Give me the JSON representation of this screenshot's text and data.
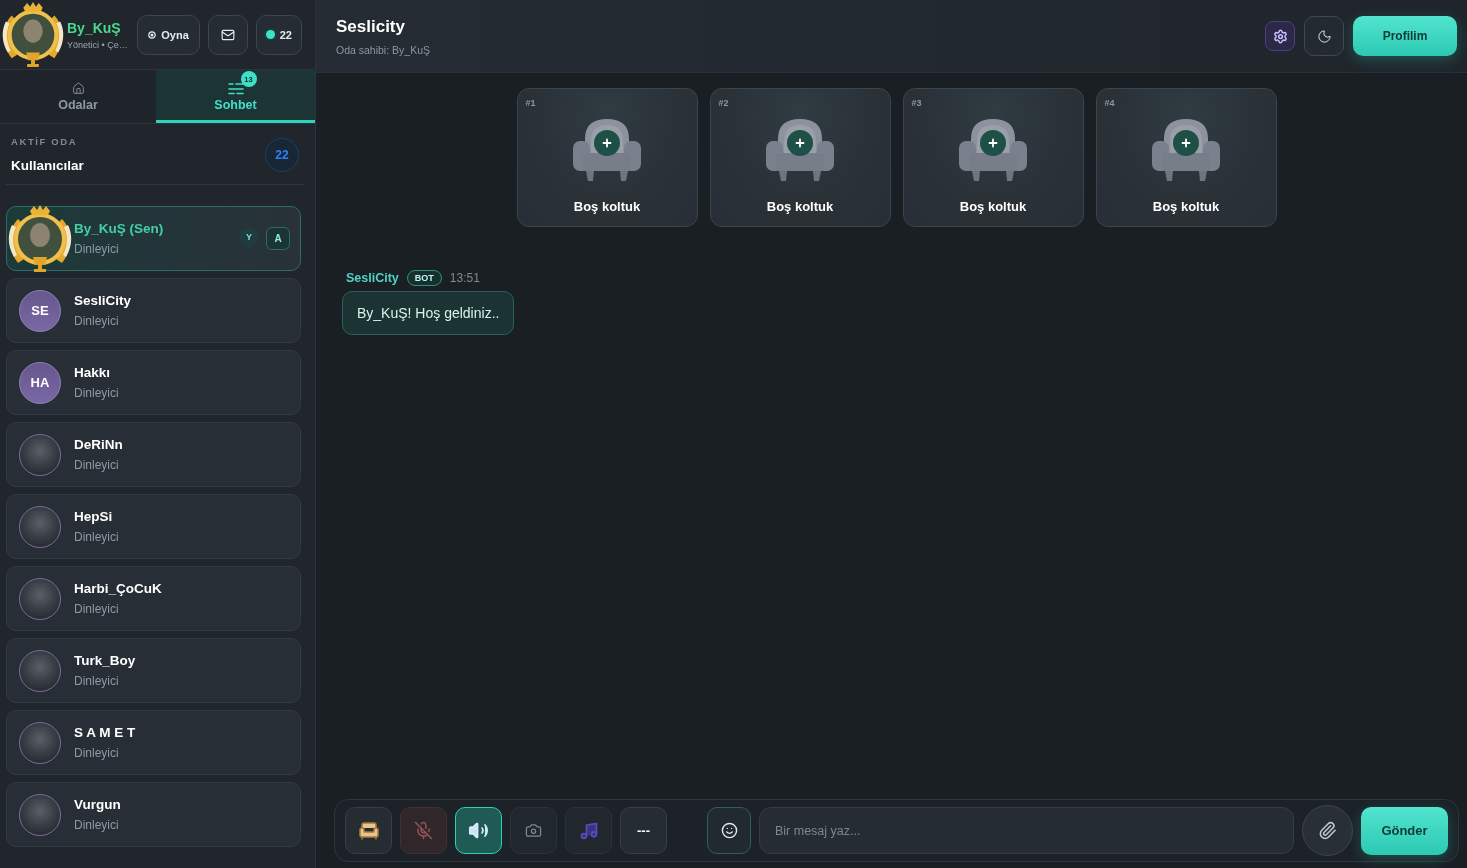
{
  "sidebar": {
    "profile": {
      "name": "By_KuŞ",
      "subtitle": "Yönetici • Çe…"
    },
    "actions": [
      {
        "kind": "play",
        "label": "Oyna"
      },
      {
        "kind": "mail"
      },
      {
        "kind": "online",
        "label": "22"
      }
    ],
    "tabs": [
      {
        "kind": "rooms",
        "label": "Odalar",
        "selected": false
      },
      {
        "kind": "chat",
        "label": "Sohbet",
        "badge": "13",
        "selected": true
      }
    ],
    "active_room": {
      "caption": "AKTİF ODA",
      "title": "Kullanıcılar",
      "count": "22"
    },
    "users": [
      {
        "kind": "self",
        "name": "By_KuŞ (Sen)",
        "role": "Dinleyici",
        "badge": "Y",
        "action": "A"
      },
      {
        "kind": "initials",
        "initials": "SE",
        "name": "SesliCity",
        "role": "Dinleyici"
      },
      {
        "kind": "initials",
        "initials": "HA",
        "name": "Hakkı",
        "role": "Dinleyici"
      },
      {
        "kind": "photo",
        "name": "DeRiNn",
        "role": "Dinleyici"
      },
      {
        "kind": "photo",
        "name": "HepSi",
        "role": "Dinleyici"
      },
      {
        "kind": "photo",
        "name": "Harbi_ÇoCuK",
        "role": "Dinleyici"
      },
      {
        "kind": "photo",
        "name": "Turk_Boy",
        "role": "Dinleyici"
      },
      {
        "kind": "photo",
        "name": "S A M E T",
        "role": "Dinleyici"
      },
      {
        "kind": "photo",
        "name": "Vurgun",
        "role": "Dinleyici"
      }
    ]
  },
  "main": {
    "header": {
      "title": "Seslicity",
      "owner": "Oda sahibi: By_KuŞ",
      "actions": [
        {
          "kind": "settings"
        },
        {
          "kind": "theme"
        },
        {
          "kind": "profile",
          "label": "Profilim"
        }
      ]
    },
    "seats": [
      {
        "number": "#1",
        "label": "Boş koltuk",
        "empty": true
      },
      {
        "number": "#2",
        "label": "Boş koltuk",
        "empty": true
      },
      {
        "number": "#3",
        "label": "Boş koltuk",
        "empty": true
      },
      {
        "number": "#4",
        "label": "Boş koltuk",
        "empty": true
      }
    ],
    "messages": [
      {
        "sender": "SesliCity",
        "badge": "BOT",
        "time": "13:51",
        "text": "By_KuŞ! Hoş geldiniz.."
      }
    ],
    "composer": {
      "tools": [
        {
          "kind": "seat",
          "on": false
        },
        {
          "kind": "mic",
          "on": false
        },
        {
          "kind": "speaker",
          "on": true
        },
        {
          "kind": "camera",
          "on": false
        },
        {
          "kind": "music",
          "on": false
        },
        {
          "kind": "more",
          "label": "---",
          "on": false
        }
      ],
      "placeholder": "Bir mesaj yaz...",
      "send": "Gönder"
    }
  }
}
